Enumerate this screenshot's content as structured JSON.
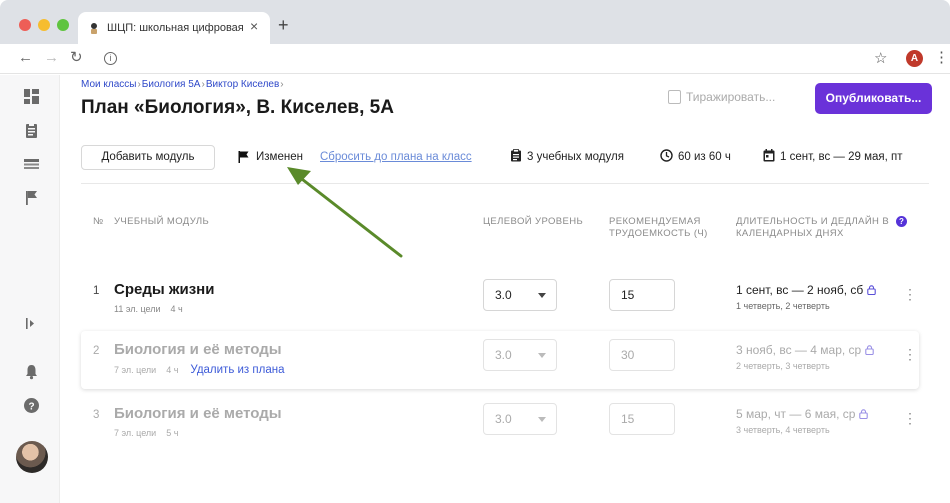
{
  "browser": {
    "tab_title": "ШЦП: школьная цифровая пла",
    "tab_close": "×",
    "new_tab": "+",
    "avatar_letter": "A"
  },
  "breadcrumb": [
    "Мои классы",
    "Биология 5А",
    "Виктор Киселев"
  ],
  "page_title": "План «Биология», В. Киселев, 5А",
  "actions": {
    "replicate": "Тиражировать...",
    "publish": "Опубликовать..."
  },
  "toolbar": {
    "add_module": "Добавить модуль",
    "status": "Изменен",
    "reset_link": "Сбросить до плана на класс",
    "modules_count": "3 учебных модуля",
    "hours": "60 из 60 ч",
    "date_range": "1 сент, вс — 29 мая, пт"
  },
  "table": {
    "headers": {
      "num": "№",
      "module": "Учебный модуль",
      "level": "Целевой уровень",
      "hours": "Рекомендуемая трудоемкость (ч)",
      "duration": "Длительность и дедлайн в календарных днях"
    },
    "help_icon": "?",
    "rows": [
      {
        "num": "1",
        "title": "Среды жизни",
        "goals": "11 эл. цели",
        "hours_small": "4 ч",
        "level": "3.0",
        "hours": "15",
        "date": "1 сент, вс — 2 нояб, сб",
        "quarters": "1 четверть, 2 четверть",
        "remove": ""
      },
      {
        "num": "2",
        "title": "Биология и её методы",
        "goals": "7 эл. цели",
        "hours_small": "4 ч",
        "level": "3.0",
        "hours": "30",
        "date": "3 нояб, вс — 4 мар, ср",
        "quarters": "2 четверть, 3 четверть",
        "remove": "Удалить из плана"
      },
      {
        "num": "3",
        "title": "Биология и её методы",
        "goals": "7 эл. цели",
        "hours_small": "5 ч",
        "level": "3.0",
        "hours": "15",
        "date": "5 мар, чт — 6 мая, ср",
        "quarters": "3 четверть, 4 четверть",
        "remove": ""
      }
    ]
  },
  "colors": {
    "accent": "#6a32d9",
    "link": "#2f49c9",
    "annotation_arrow": "#5a8a2a"
  },
  "icons": [
    "dashboard-icon",
    "clipboard-icon",
    "table-icon",
    "flag-icon",
    "expand-sidebar-icon",
    "bell-icon",
    "help-icon",
    "clock-icon",
    "calendar-icon",
    "lock-icon",
    "kebab-menu-icon"
  ]
}
